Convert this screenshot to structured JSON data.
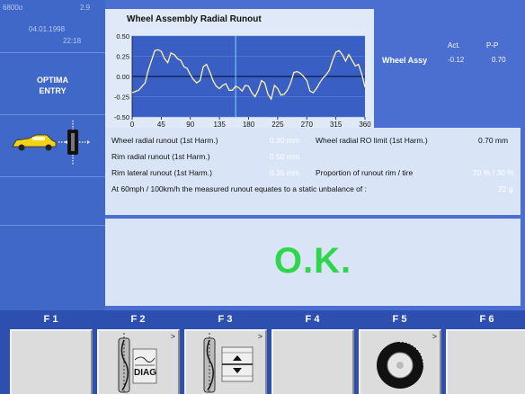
{
  "sidebar": {
    "code": "6800o",
    "version": "2.9",
    "date": "04.01.1998",
    "time": "22:18",
    "mode_line1": "OPTIMA",
    "mode_line2": "ENTRY"
  },
  "readout": {
    "label": "Wheel Assy",
    "col_act": "Act.",
    "col_pp": "P-P",
    "act_value": "-0.12",
    "pp_value": "0.70"
  },
  "measurements": {
    "wheel_radial_runout_label": "Wheel radial runout (1st Harm.)",
    "wheel_radial_runout_value": "0.30 mm",
    "rim_radial_runout_label": "Rim radial runout (1st Harm.)",
    "rim_radial_runout_value": "0.50 mm",
    "rim_lateral_runout_label": "Rim lateral runout (1st Harm.)",
    "rim_lateral_runout_value": "0.35 mm",
    "wheel_radial_ro_limit_label": "Wheel radial RO limit (1st Harm.)",
    "wheel_radial_ro_limit_value": "0.70 mm",
    "proportion_label": "Proportion of runout rim / tire",
    "proportion_value": "70 % / 30 %",
    "unbalance_label": "At 60mph / 100km/h the measured runout equates to a static unbalance of :",
    "unbalance_value": "22 g"
  },
  "status": "O.K.",
  "function_keys": [
    "F 1",
    "F 2",
    "F 3",
    "F 4",
    "F 5",
    "F 6"
  ],
  "diag_label": "DIAG",
  "chart_data": {
    "type": "line",
    "title": "Wheel Assembly Radial Runout",
    "xlabel": "",
    "ylabel": "",
    "xlim": [
      0,
      360
    ],
    "ylim": [
      -0.5,
      0.5
    ],
    "x_ticks": [
      "0",
      "45",
      "90",
      "135",
      "180",
      "225",
      "270",
      "315",
      "360"
    ],
    "y_ticks": [
      "0.50",
      "0.25",
      "0.00",
      "-0.25",
      "-0.50"
    ],
    "grid": true,
    "marker_x": 160,
    "series": [
      {
        "x": [
          0,
          10,
          20,
          25,
          30,
          35,
          40,
          45,
          50,
          55,
          60,
          65,
          70,
          75,
          80,
          85,
          90,
          95,
          100,
          105,
          110,
          115,
          120,
          125,
          130,
          135,
          140,
          145,
          150,
          155,
          160,
          165,
          170,
          175,
          180,
          185,
          190,
          195,
          200,
          205,
          210,
          215,
          220,
          225,
          230,
          235,
          240,
          245,
          250,
          255,
          260,
          265,
          270,
          275,
          280,
          285,
          290,
          295,
          300,
          305,
          310,
          315,
          320,
          325,
          330,
          335,
          340,
          345,
          350,
          355,
          360
        ],
        "y": [
          -0.2,
          -0.17,
          -0.08,
          0.08,
          0.2,
          0.32,
          0.33,
          0.31,
          0.22,
          0.17,
          0.29,
          0.27,
          0.22,
          0.2,
          0.12,
          0.1,
          0.02,
          -0.04,
          -0.08,
          -0.05,
          0.12,
          0.15,
          0.06,
          -0.05,
          -0.12,
          -0.15,
          -0.11,
          -0.09,
          -0.17,
          -0.17,
          -0.12,
          -0.14,
          -0.18,
          -0.11,
          -0.12,
          -0.2,
          -0.25,
          -0.17,
          -0.05,
          -0.08,
          -0.22,
          -0.28,
          -0.11,
          -0.15,
          -0.23,
          -0.22,
          -0.17,
          -0.08,
          0.05,
          0.06,
          0.04,
          0.0,
          -0.05,
          -0.18,
          -0.2,
          -0.15,
          -0.08,
          -0.02,
          0.02,
          0.08,
          0.2,
          0.3,
          0.32,
          0.27,
          0.19,
          0.27,
          0.2,
          0.13,
          0.15,
          0.03,
          -0.13
        ]
      }
    ]
  }
}
